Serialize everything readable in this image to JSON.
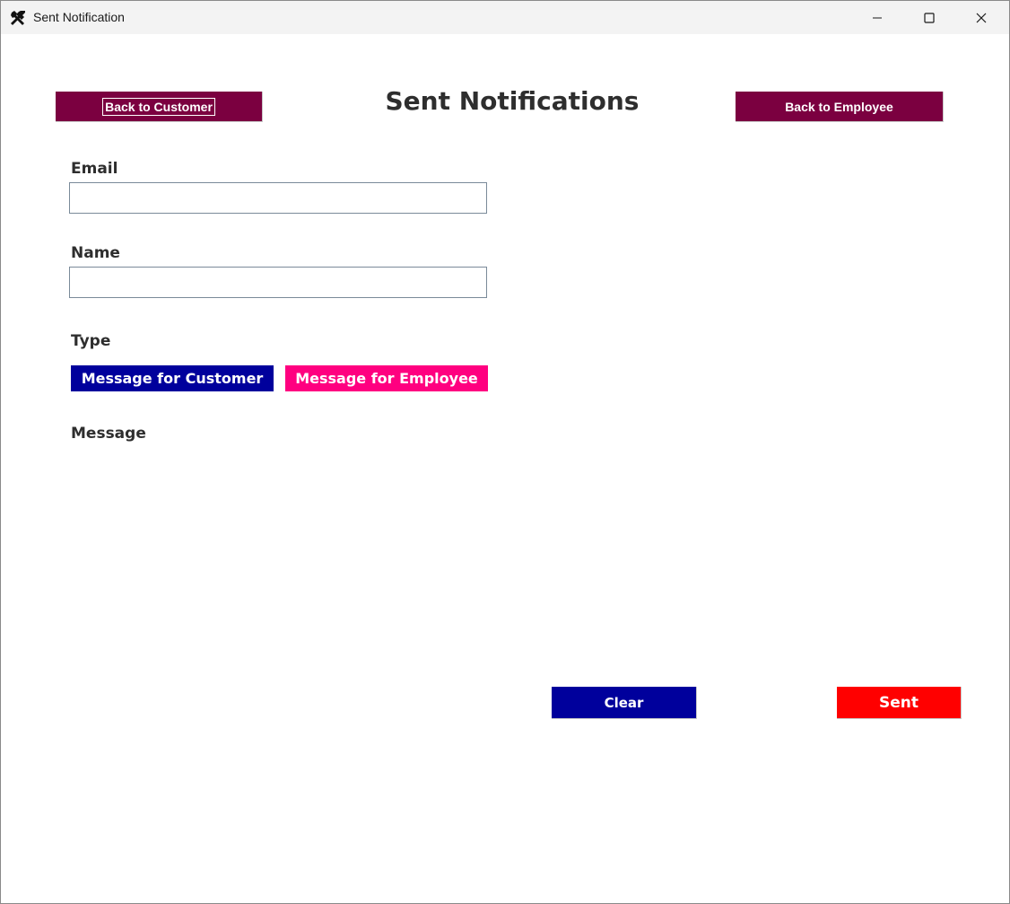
{
  "window": {
    "title": "Sent Notification",
    "app_icon": "tools-icon",
    "controls": [
      "minimize-icon",
      "maximize-icon",
      "close-icon"
    ]
  },
  "header": {
    "title": "Sent Notifications",
    "back_customer_label": "Back to Customer",
    "back_employee_label": "Back to Employee"
  },
  "form": {
    "email_label": "Email",
    "email_value": "",
    "name_label": "Name",
    "name_value": "",
    "type_label": "Type",
    "type_customer_label": "Message for Customer",
    "type_employee_label": "Message for Employee",
    "message_label": "Message"
  },
  "actions": {
    "clear_label": "Clear",
    "sent_label": "Sent"
  },
  "colors": {
    "nav_button": "#7b0040",
    "customer_type": "#00009c",
    "employee_type": "#ff0080",
    "clear": "#00009c",
    "sent": "#ff0000"
  }
}
